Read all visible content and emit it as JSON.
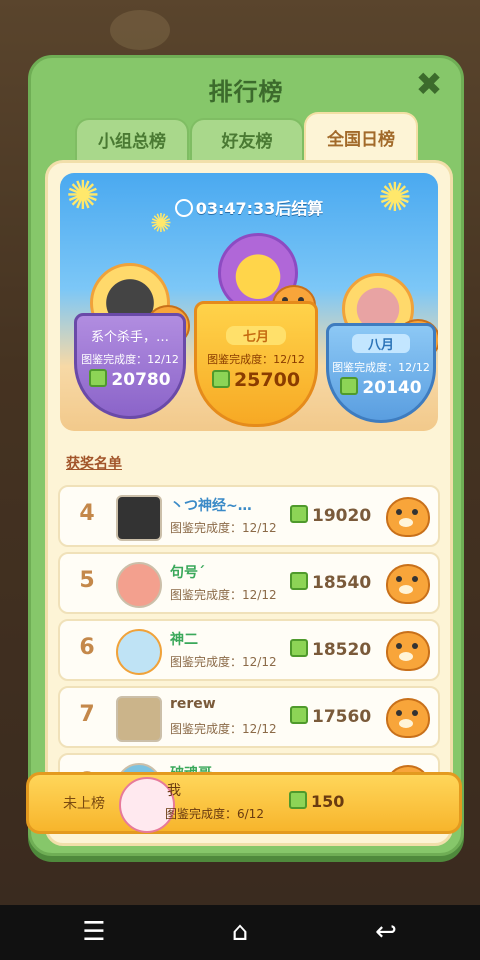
{
  "modal": {
    "title": "排行榜"
  },
  "tabs": [
    {
      "label": "小组总榜",
      "active": false
    },
    {
      "label": "好友榜",
      "active": false
    },
    {
      "label": "全国日榜",
      "active": true
    }
  ],
  "timer": {
    "text": "03:47:33后结算"
  },
  "podium": [
    {
      "place": 1,
      "name": "七月",
      "progress": "图鉴完成度：12/12",
      "score": "25700"
    },
    {
      "place": 2,
      "name": "系个杀手，…",
      "progress": "图鉴完成度：12/12",
      "score": "20780"
    },
    {
      "place": 3,
      "name": "八月",
      "progress": "图鉴完成度：12/12",
      "score": "20140"
    }
  ],
  "winners_label": "获奖名单",
  "list": [
    {
      "rank": "4",
      "name": "丶つ神经~…",
      "progress": "图鉴完成度：12/12",
      "score": "19020"
    },
    {
      "rank": "5",
      "name": "句号´",
      "progress": "图鉴完成度：12/12",
      "score": "18540"
    },
    {
      "rank": "6",
      "name": "神二",
      "progress": "图鉴完成度：12/12",
      "score": "18520"
    },
    {
      "rank": "7",
      "name": "rerew",
      "progress": "图鉴完成度：12/12",
      "score": "17560"
    },
    {
      "rank": "8",
      "name": "破魂哥",
      "progress": "",
      "score": ""
    }
  ],
  "me": {
    "status": "未上榜",
    "name": "我",
    "progress": "图鉴完成度：6/12",
    "score": "150"
  },
  "colors": {
    "modal_green": "#86c76a",
    "panel_cream": "#fdf4d6",
    "accent_orange": "#f7b52c"
  }
}
